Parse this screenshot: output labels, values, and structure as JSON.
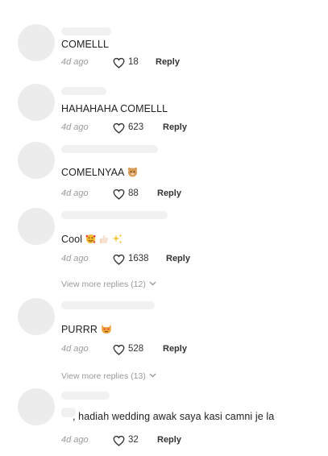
{
  "reply_label": "Reply",
  "comments": [
    {
      "text": "COMELLL",
      "time": "4d ago",
      "likes": "18",
      "emoji": []
    },
    {
      "text": "HAHAHAHA COMELLL",
      "time": "4d ago",
      "likes": "623",
      "emoji": []
    },
    {
      "text": "COMELNYAA",
      "time": "4d ago",
      "likes": "88",
      "emoji": [
        "hamster-face-emoji"
      ]
    },
    {
      "text": "Cool",
      "time": "4d ago",
      "likes": "1638",
      "emoji": [
        "smiling-face-with-hearts-emoji",
        "thumbs-up-emoji",
        "sparkles-emoji"
      ],
      "view_more": "View more replies (12)"
    },
    {
      "text": "PURRR",
      "time": "4d ago",
      "likes": "528",
      "emoji": [
        "heart-eyes-cat-emoji"
      ],
      "view_more": "View more replies (13)"
    },
    {
      "text": ", hadiah wedding awak saya kasi camni je la",
      "time": "4d ago",
      "likes": "32",
      "emoji": []
    }
  ],
  "colors": {
    "avatar_placeholder": "#ececec",
    "comment_text": "#222222",
    "meta_text": "#9a9a9a",
    "reply_text": "#333333"
  }
}
